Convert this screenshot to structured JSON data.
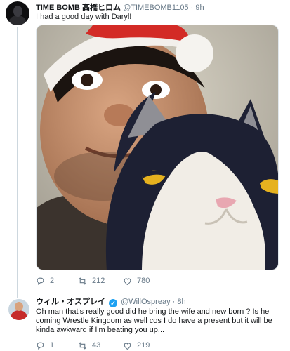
{
  "tweets": [
    {
      "display_name": "TIME BOMB 高橋ヒロム",
      "handle": "@TIMEBOMB1105",
      "time": "9h",
      "text": "I had a good day with Daryl!",
      "replies": "2",
      "retweets": "212",
      "likes": "780",
      "verified": false
    },
    {
      "display_name": "ウィル・オスプレイ",
      "handle": "@WillOspreay",
      "time": "8h",
      "text": "Oh man that's really good did he bring the wife and new born ? Is he coming Wrestle Kingdom as well cos I do have a present but it will be kinda awkward if I'm beating you up...",
      "replies": "1",
      "retweets": "43",
      "likes": "219",
      "verified": true
    }
  ],
  "separator": "·",
  "icons": {
    "reply": "reply-icon",
    "retweet": "retweet-icon",
    "like": "heart-icon",
    "verified": "verified-badge-icon"
  },
  "colors": {
    "accent": "#1da1f2",
    "muted": "#657786",
    "text": "#14171a",
    "santa_hat": "#d32b26"
  }
}
